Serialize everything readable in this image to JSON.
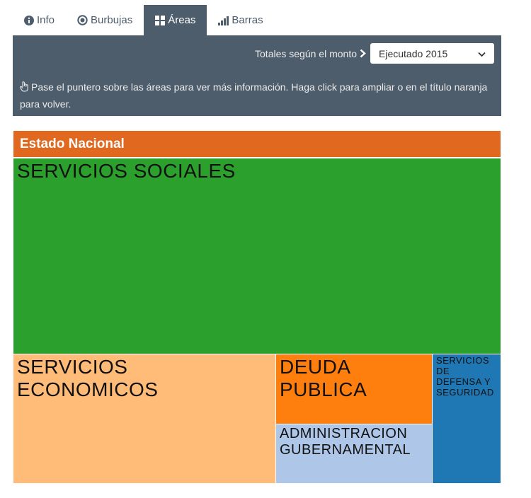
{
  "tabs": [
    {
      "label": "Info",
      "icon": "info-circle-icon",
      "active": false
    },
    {
      "label": "Burbujas",
      "icon": "dot-circle-icon",
      "active": false
    },
    {
      "label": "Áreas",
      "icon": "grid-icon",
      "active": true
    },
    {
      "label": "Barras",
      "icon": "bar-chart-icon",
      "active": false
    }
  ],
  "panel": {
    "select_label": "Totales según el monto",
    "select_value": "Ejecutado 2015",
    "hint": "Pase el puntero sobre las áreas para ver más información. Haga click para ampliar o en el título naranja para volver."
  },
  "treemap": {
    "title": "Estado Nacional",
    "cells": [
      {
        "label": "SERVICIOS SOCIALES",
        "color": "#2ca02c"
      },
      {
        "label": "SERVICIOS ECONOMICOS",
        "color": "#ffbb78"
      },
      {
        "label": "DEUDA PUBLICA",
        "color": "#ff7f0e"
      },
      {
        "label": "ADMINISTRACION GUBERNAMENTAL",
        "color": "#aec7e8"
      },
      {
        "label": "SERVICIOS DE DEFENSA Y SEGURIDAD",
        "color": "#1f77b4"
      }
    ]
  },
  "colors": {
    "panel_bg": "#4e5d6c",
    "header_bg": "#e0691f"
  }
}
